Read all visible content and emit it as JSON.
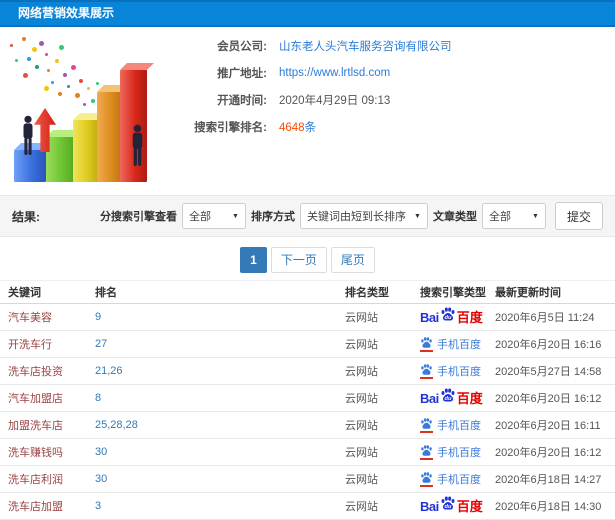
{
  "header": {
    "title": "网络营销效果展示"
  },
  "info": {
    "rows": [
      {
        "label": "会员公司:",
        "value": "山东老人头汽车服务咨询有限公司",
        "type": "link"
      },
      {
        "label": "推广地址:",
        "value": "https://www.lrtlsd.com",
        "type": "link"
      },
      {
        "label": "开通时间:",
        "value": "2020年4月29日 09:13",
        "type": "text"
      },
      {
        "label": "搜索引擎排名:",
        "value": "4648",
        "suffix": "条",
        "type": "highlight"
      }
    ]
  },
  "filters": {
    "result_label": "结果:",
    "engine_label": "分搜索引擎查看",
    "engine_value": "全部",
    "sort_label": "排序方式",
    "sort_value": "关键词由短到长排序",
    "article_label": "文章类型",
    "article_value": "全部",
    "submit_label": "提交"
  },
  "pagination": {
    "current": "1",
    "next": "下一页",
    "last": "尾页"
  },
  "table": {
    "headers": [
      "关键词",
      "排名",
      "排名类型",
      "搜索引擎类型",
      "最新更新时间"
    ],
    "rows": [
      {
        "keyword": "汽车美容",
        "rank": "9",
        "rank_type": "云网站",
        "engine": "baidu",
        "time": "2020年6月5日 11:24"
      },
      {
        "keyword": "开洗车行",
        "rank": "27",
        "rank_type": "云网站",
        "engine": "mobile",
        "time": "2020年6月20日 16:16"
      },
      {
        "keyword": "洗车店投资",
        "rank": "21,26",
        "rank_type": "云网站",
        "engine": "mobile",
        "time": "2020年5月27日 14:58"
      },
      {
        "keyword": "汽车加盟店",
        "rank": "8",
        "rank_type": "云网站",
        "engine": "baidu",
        "time": "2020年6月20日 16:12"
      },
      {
        "keyword": "加盟洗车店",
        "rank": "25,28,28",
        "rank_type": "云网站",
        "engine": "mobile",
        "time": "2020年6月20日 16:11"
      },
      {
        "keyword": "洗车赚钱吗",
        "rank": "30",
        "rank_type": "云网站",
        "engine": "mobile",
        "time": "2020年6月20日 16:12"
      },
      {
        "keyword": "洗车店利润",
        "rank": "30",
        "rank_type": "云网站",
        "engine": "mobile",
        "time": "2020年6月18日 14:27"
      },
      {
        "keyword": "洗车店加盟",
        "rank": "3",
        "rank_type": "云网站",
        "engine": "baidu",
        "time": "2020年6月18日 14:30"
      }
    ]
  },
  "engines": {
    "baidu_bai": "Bai",
    "baidu_du": "du",
    "baidu_cn": "百度",
    "mobile_label": "手机百度"
  },
  "colors": {
    "header_blue": "#0884d8",
    "link_blue": "#2b7cd9",
    "highlight_red": "#ff4a00",
    "keyword_maroon": "#9a4343",
    "baidu_blue": "#2133d6",
    "baidu_red": "#e60000",
    "pagination_blue": "#337ab7"
  }
}
